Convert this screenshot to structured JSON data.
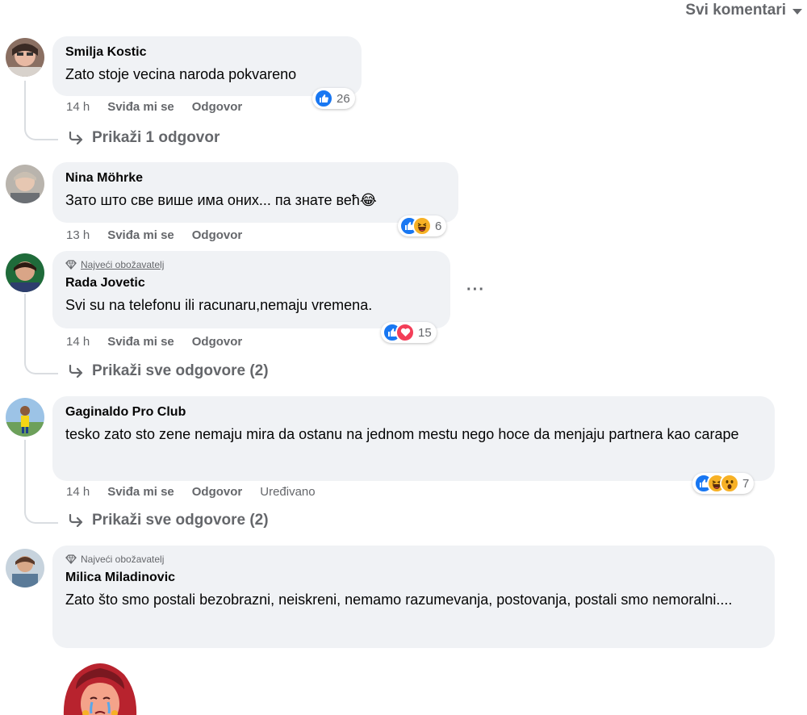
{
  "filter": {
    "label": "Svi komentari"
  },
  "comments": [
    {
      "author": "Smilja Kostic",
      "text": "Zato stoje vecina naroda pokvareno",
      "time": "14 h",
      "like": "Sviđa mi se",
      "reply": "Odgovor",
      "reaction_count": "26",
      "reactions": [
        "like"
      ],
      "replies_label": "Prikaži 1 odgovor"
    },
    {
      "author": "Nina Möhrke",
      "text": "Зато што све више има оних... па знате већ😂",
      "time": "13 h",
      "like": "Sviđa mi se",
      "reply": "Odgovor",
      "reaction_count": "6",
      "reactions": [
        "like",
        "haha"
      ]
    },
    {
      "badge": "Najveći obožavatelj",
      "author": "Rada Jovetic",
      "text": "Svi su na telefonu ili racunaru,nemaju vremena.",
      "time": "14 h",
      "like": "Sviđa mi se",
      "reply": "Odgovor",
      "reaction_count": "15",
      "reactions": [
        "like",
        "love"
      ],
      "replies_label": "Prikaži sve odgovore (2)",
      "more": "···"
    },
    {
      "author": "Gaginaldo Pro Club",
      "text": "tesko zato sto zene nemaju mira da ostanu na jednom mestu nego hoce da menjaju partnera kao carape",
      "time": "14 h",
      "like": "Sviđa mi se",
      "reply": "Odgovor",
      "edited": "Uređivano",
      "reaction_count": "7",
      "reactions": [
        "like",
        "haha",
        "wow"
      ],
      "replies_label": "Prikaži sve odgovore (2)"
    },
    {
      "badge": "Najveći obožavatelj",
      "author": "Milica Miladinovic",
      "text": "Zato što smo postali bezobrazni, neiskreni, nemamo razumevanja, postovanja, postali smo nemoralni...."
    }
  ],
  "colors": {
    "like": "#1877f2",
    "love": "#f33e58",
    "haha": "#f7b125",
    "bubble": "#f0f2f5",
    "secondary_text": "#65676b"
  },
  "icons": [
    "diamond-icon",
    "reply-arrow-icon",
    "like-icon",
    "love-icon",
    "haha-icon",
    "wow-icon",
    "more-icon",
    "caret-down-icon"
  ]
}
